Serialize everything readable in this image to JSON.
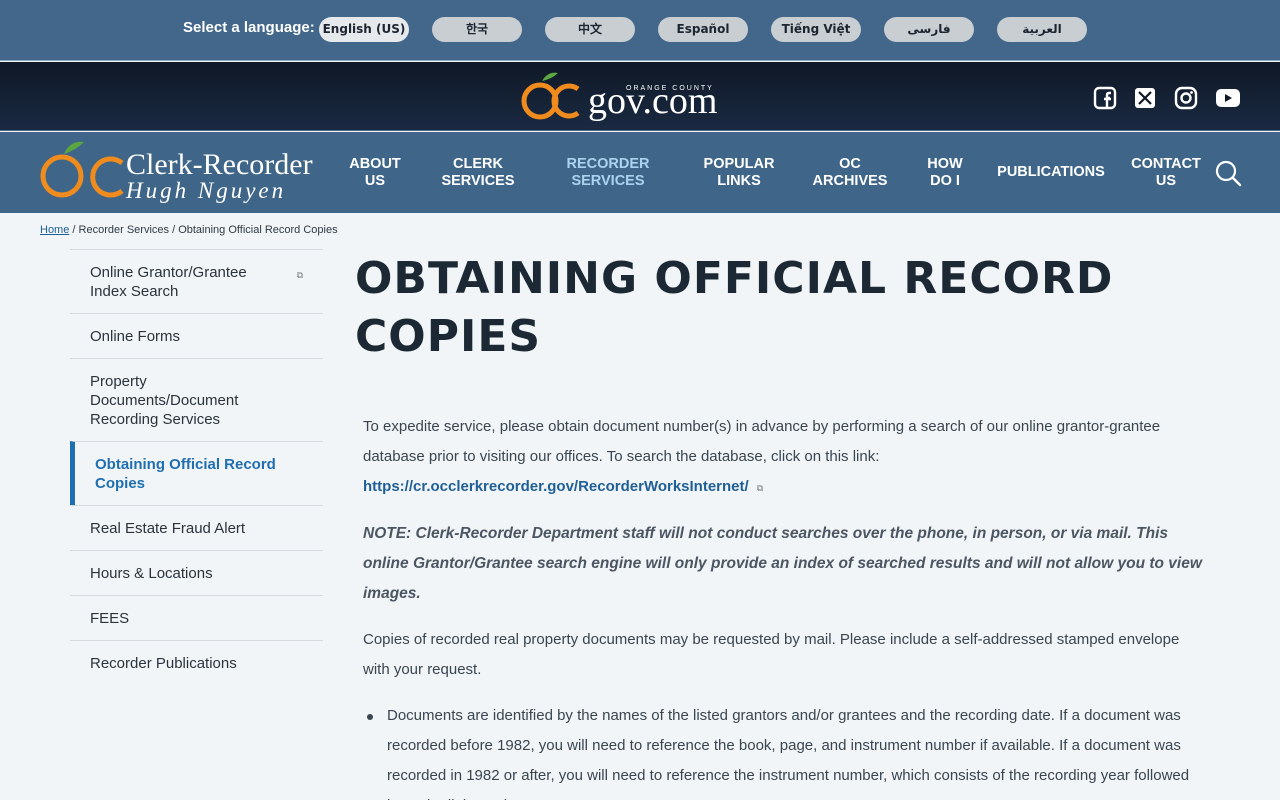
{
  "language_bar": {
    "label": "Select a language:",
    "languages": [
      "English (US)",
      "한국",
      "中文",
      "Español",
      "Tiếng Việt",
      "فارسی",
      "العربية"
    ]
  },
  "gov_bar": {
    "logo_text": "gov.com",
    "logo_small": "ORANGE COUNTY",
    "social": [
      "facebook-icon",
      "x-icon",
      "instagram-icon",
      "youtube-icon"
    ]
  },
  "nav": {
    "logo_title": "Clerk-Recorder",
    "logo_subtitle": "Hugh Nguyen",
    "items": [
      {
        "line1": "ABOUT",
        "line2": "US"
      },
      {
        "line1": "CLERK",
        "line2": "SERVICES"
      },
      {
        "line1": "RECORDER",
        "line2": "SERVICES"
      },
      {
        "line1": "POPULAR",
        "line2": "LINKS"
      },
      {
        "line1": "OC",
        "line2": "ARCHIVES"
      },
      {
        "line1": "HOW",
        "line2": "DO I"
      },
      {
        "line1": "PUBLICATIONS",
        "line2": ""
      },
      {
        "line1": "CONTACT",
        "line2": "US"
      }
    ]
  },
  "breadcrumb": {
    "home": "Home",
    "sep": "/",
    "section": "Recorder Services",
    "current": "Obtaining Official Record Copies"
  },
  "sidebar": {
    "items": [
      {
        "label": "Online Grantor/Grantee Index Search",
        "external": true
      },
      {
        "label": "Online Forms"
      },
      {
        "label": "Property Documents/Document Recording Services"
      },
      {
        "label": "Obtaining Official Record Copies",
        "active": true
      },
      {
        "label": "Real Estate Fraud Alert"
      },
      {
        "label": "Hours & Locations"
      },
      {
        "label": "FEES"
      },
      {
        "label": "Recorder Publications"
      }
    ]
  },
  "main": {
    "title": "OBTAINING OFFICIAL RECORD COPIES",
    "intro_text": "To expedite service, please obtain document number(s) in advance by performing a search of our online grantor-grantee database prior to visiting our offices.  To search the database, click on this link: ",
    "intro_link": "https://cr.occlerkrecorder.gov/RecorderWorksInternet/",
    "note": "NOTE: Clerk-Recorder Department staff will not conduct searches over the phone, in person, or via mail. This online Grantor/Grantee search engine will only provide an index of searched results and will not allow you to view images.",
    "copies_text": "Copies of recorded real property documents may be requested by mail. Please include a self-addressed stamped envelope with your request.",
    "bullets": [
      "Documents are identified by the names of the listed grantors and/or grantees and the recording date. If a document was recorded before 1982, you will need to reference the book, page, and instrument number if available. If a document was recorded in 1982 or after, you will need to reference the instrument number, which consists of the recording year followed by a six-digit number."
    ]
  },
  "colors": {
    "lang_bar_bg": "#42678a",
    "gov_bar_bg": "#0f1826",
    "nav_bg": "#3f6688",
    "accent_orange": "#f08c1e",
    "link_blue": "#1f5f96",
    "active_blue": "#1f6fb0"
  }
}
